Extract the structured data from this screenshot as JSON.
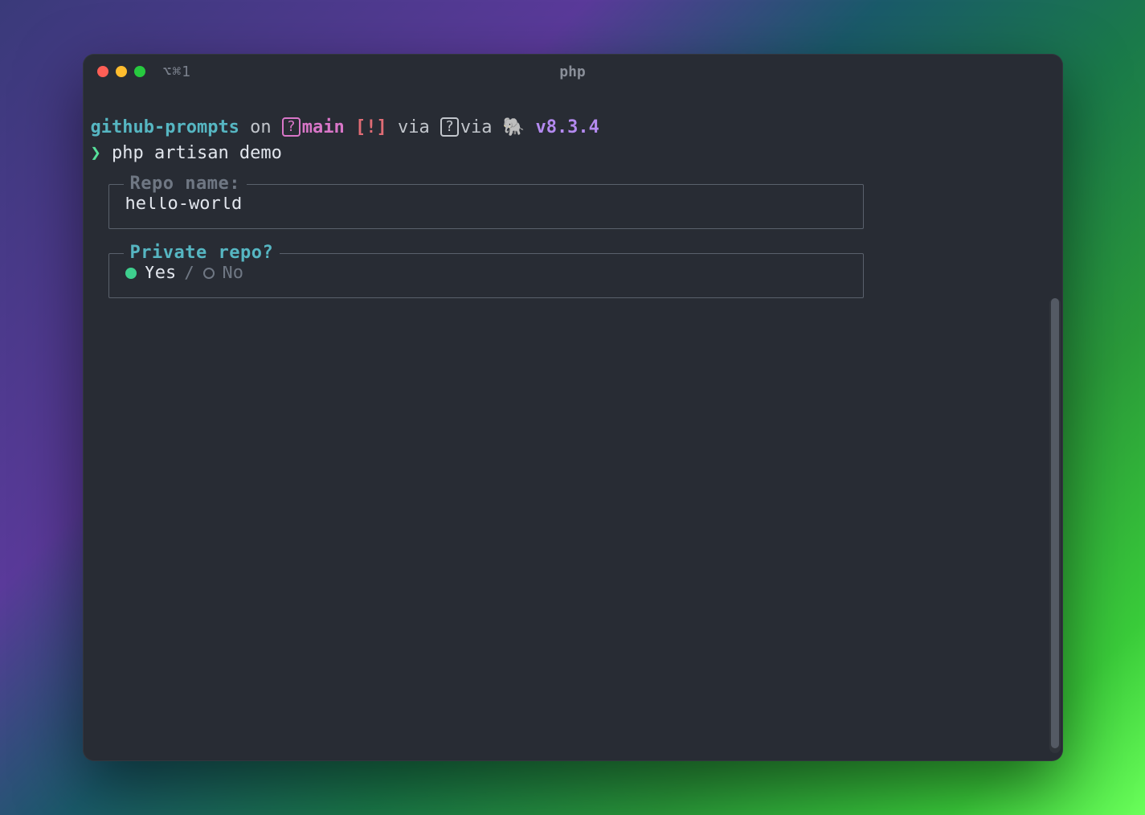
{
  "window": {
    "tab_label": "⌥⌘1",
    "title": "php"
  },
  "prompt": {
    "dir": "github-prompts",
    "on": " on ",
    "branch_box": "?",
    "branch": "main",
    "dirty": " [!]",
    "via1": " via ",
    "via_box": "?",
    "via2": "via ",
    "elephant": "🐘",
    "version": " v8.3.4",
    "arrow": "❯",
    "command": " php artisan demo"
  },
  "fields": {
    "repo_name_label": "Repo name:",
    "repo_name_value": "hello-world",
    "private_label": "Private repo?",
    "private_yes": "Yes",
    "private_separator": "/",
    "private_no": "No",
    "private_selected": "yes"
  }
}
